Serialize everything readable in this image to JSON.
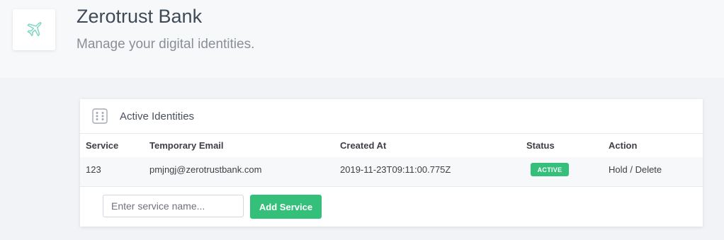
{
  "header": {
    "title": "Zerotrust Bank",
    "subtitle": "Manage your digital identities.",
    "logo_icon": "airplane-icon"
  },
  "card": {
    "title": "Active Identities",
    "icon": "dice-icon",
    "columns": [
      "Service",
      "Temporary Email",
      "Created At",
      "Status",
      "Action"
    ],
    "rows": [
      {
        "service": "123",
        "email": "pmjngj@zerotrustbank.com",
        "created_at": "2019-11-23T09:11:00.775Z",
        "status": "ACTIVE",
        "action": "Hold / Delete"
      }
    ]
  },
  "form": {
    "placeholder": "Enter service name...",
    "button_label": "Add Service"
  },
  "colors": {
    "accent": "#34bf7b",
    "icon_teal": "#7fd6c2"
  }
}
